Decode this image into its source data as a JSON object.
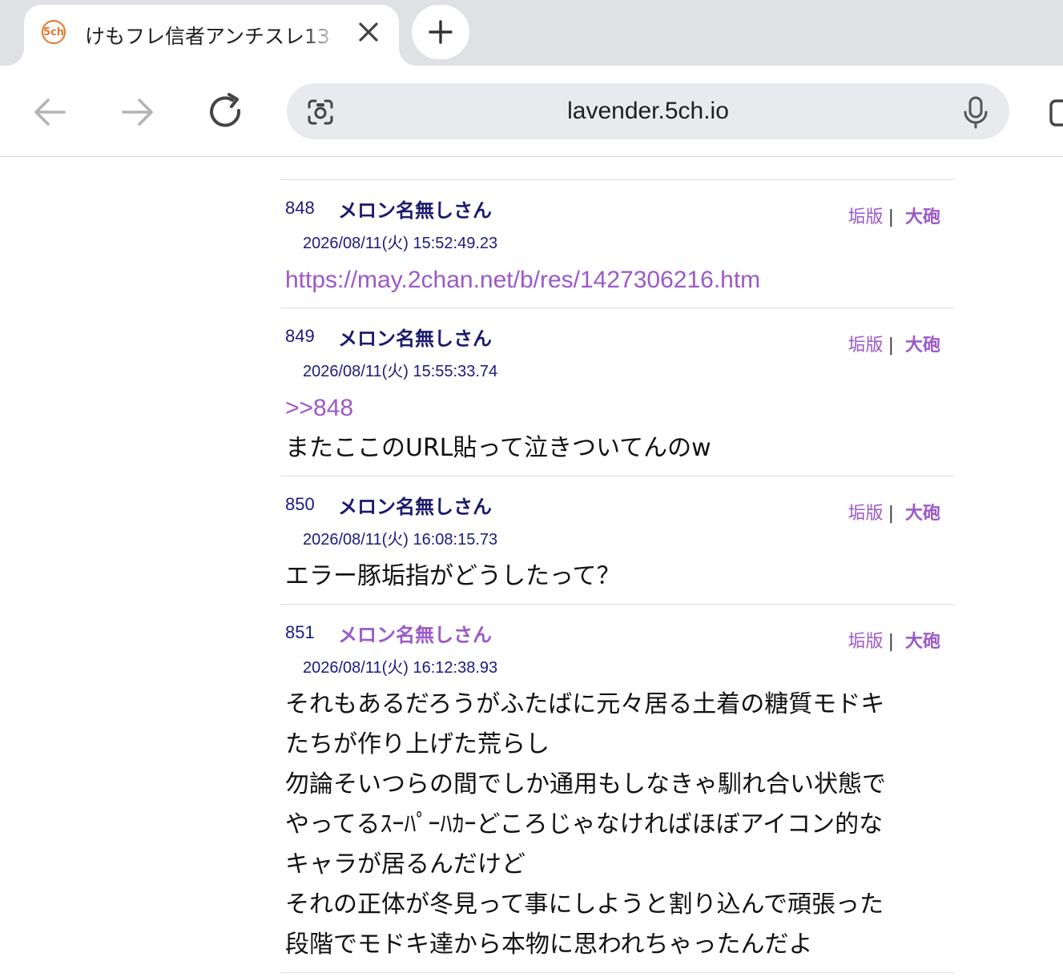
{
  "browser": {
    "tab": {
      "favicon_text": "5ch",
      "title": "けもフレ信者アンチスレ13"
    },
    "omnibox": {
      "url": "lavender.5ch.io"
    }
  },
  "posts": [
    {
      "number": "848",
      "name": "メロン名無しさん",
      "date": "2026/08/11(火) 15:52:49.23",
      "action_dump": "垢版",
      "action_sep": "|",
      "action_cannon": "大砲",
      "link": "https://may.2chan.net/b/res/1427306216.htm",
      "lines": []
    },
    {
      "number": "849",
      "name": "メロン名無しさん",
      "date": "2026/08/11(火) 15:55:33.74",
      "action_dump": "垢版",
      "action_sep": "|",
      "action_cannon": "大砲",
      "link": ">>848",
      "lines": [
        "またここのURL貼って泣きついてんのw"
      ]
    },
    {
      "number": "850",
      "name": "メロン名無しさん",
      "date": "2026/08/11(火) 16:08:15.73",
      "action_dump": "垢版",
      "action_sep": "|",
      "action_cannon": "大砲",
      "lines": [
        "エラー豚垢指がどうしたって？"
      ]
    },
    {
      "number": "851",
      "name": "メロン名無しさん",
      "date": "2026/08/11(火) 16:12:38.93",
      "action_dump": "垢版",
      "action_sep": "|",
      "action_cannon": "大砲",
      "lines": [
        "それもあるだろうがふたばに元々居る土着の糖質モドキ",
        "たちが作り上げた荒らし",
        "勿論そいつらの間でしか通用もしなきゃ馴れ合い状態で",
        "やってるｽｰﾊﾟｰﾊｶｰどころじゃなければほぼアイコン的な",
        "キャラが居るんだけど",
        "それの正体が冬見って事にしようと割り込んで頑張った",
        "段階でモドキ達から本物に思われちゃったんだよ"
      ]
    }
  ],
  "colors": {
    "tabstrip_bg": "#dfe1e5",
    "omnibox_bg": "#e9eaee",
    "link": "#9b59c7",
    "post_meta": "#1a1a80"
  }
}
